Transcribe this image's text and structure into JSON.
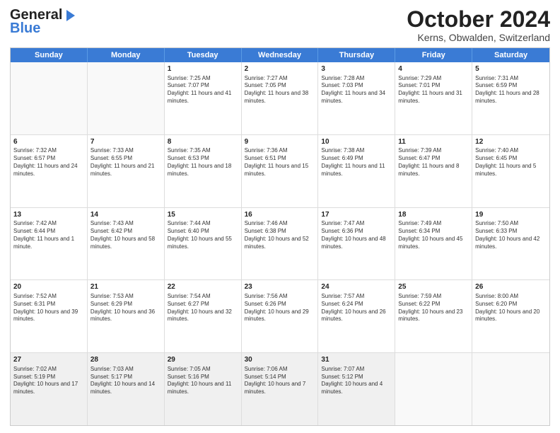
{
  "logo": {
    "line1": "General",
    "line2": "Blue"
  },
  "title": "October 2024",
  "subtitle": "Kerns, Obwalden, Switzerland",
  "days": [
    "Sunday",
    "Monday",
    "Tuesday",
    "Wednesday",
    "Thursday",
    "Friday",
    "Saturday"
  ],
  "weeks": [
    [
      {
        "day": "",
        "text": "",
        "empty": true
      },
      {
        "day": "",
        "text": "",
        "empty": true
      },
      {
        "day": "1",
        "text": "Sunrise: 7:25 AM\nSunset: 7:07 PM\nDaylight: 11 hours and 41 minutes."
      },
      {
        "day": "2",
        "text": "Sunrise: 7:27 AM\nSunset: 7:05 PM\nDaylight: 11 hours and 38 minutes."
      },
      {
        "day": "3",
        "text": "Sunrise: 7:28 AM\nSunset: 7:03 PM\nDaylight: 11 hours and 34 minutes."
      },
      {
        "day": "4",
        "text": "Sunrise: 7:29 AM\nSunset: 7:01 PM\nDaylight: 11 hours and 31 minutes."
      },
      {
        "day": "5",
        "text": "Sunrise: 7:31 AM\nSunset: 6:59 PM\nDaylight: 11 hours and 28 minutes."
      }
    ],
    [
      {
        "day": "6",
        "text": "Sunrise: 7:32 AM\nSunset: 6:57 PM\nDaylight: 11 hours and 24 minutes."
      },
      {
        "day": "7",
        "text": "Sunrise: 7:33 AM\nSunset: 6:55 PM\nDaylight: 11 hours and 21 minutes."
      },
      {
        "day": "8",
        "text": "Sunrise: 7:35 AM\nSunset: 6:53 PM\nDaylight: 11 hours and 18 minutes."
      },
      {
        "day": "9",
        "text": "Sunrise: 7:36 AM\nSunset: 6:51 PM\nDaylight: 11 hours and 15 minutes."
      },
      {
        "day": "10",
        "text": "Sunrise: 7:38 AM\nSunset: 6:49 PM\nDaylight: 11 hours and 11 minutes."
      },
      {
        "day": "11",
        "text": "Sunrise: 7:39 AM\nSunset: 6:47 PM\nDaylight: 11 hours and 8 minutes."
      },
      {
        "day": "12",
        "text": "Sunrise: 7:40 AM\nSunset: 6:45 PM\nDaylight: 11 hours and 5 minutes."
      }
    ],
    [
      {
        "day": "13",
        "text": "Sunrise: 7:42 AM\nSunset: 6:44 PM\nDaylight: 11 hours and 1 minute."
      },
      {
        "day": "14",
        "text": "Sunrise: 7:43 AM\nSunset: 6:42 PM\nDaylight: 10 hours and 58 minutes."
      },
      {
        "day": "15",
        "text": "Sunrise: 7:44 AM\nSunset: 6:40 PM\nDaylight: 10 hours and 55 minutes."
      },
      {
        "day": "16",
        "text": "Sunrise: 7:46 AM\nSunset: 6:38 PM\nDaylight: 10 hours and 52 minutes."
      },
      {
        "day": "17",
        "text": "Sunrise: 7:47 AM\nSunset: 6:36 PM\nDaylight: 10 hours and 48 minutes."
      },
      {
        "day": "18",
        "text": "Sunrise: 7:49 AM\nSunset: 6:34 PM\nDaylight: 10 hours and 45 minutes."
      },
      {
        "day": "19",
        "text": "Sunrise: 7:50 AM\nSunset: 6:33 PM\nDaylight: 10 hours and 42 minutes."
      }
    ],
    [
      {
        "day": "20",
        "text": "Sunrise: 7:52 AM\nSunset: 6:31 PM\nDaylight: 10 hours and 39 minutes."
      },
      {
        "day": "21",
        "text": "Sunrise: 7:53 AM\nSunset: 6:29 PM\nDaylight: 10 hours and 36 minutes."
      },
      {
        "day": "22",
        "text": "Sunrise: 7:54 AM\nSunset: 6:27 PM\nDaylight: 10 hours and 32 minutes."
      },
      {
        "day": "23",
        "text": "Sunrise: 7:56 AM\nSunset: 6:26 PM\nDaylight: 10 hours and 29 minutes."
      },
      {
        "day": "24",
        "text": "Sunrise: 7:57 AM\nSunset: 6:24 PM\nDaylight: 10 hours and 26 minutes."
      },
      {
        "day": "25",
        "text": "Sunrise: 7:59 AM\nSunset: 6:22 PM\nDaylight: 10 hours and 23 minutes."
      },
      {
        "day": "26",
        "text": "Sunrise: 8:00 AM\nSunset: 6:20 PM\nDaylight: 10 hours and 20 minutes."
      }
    ],
    [
      {
        "day": "27",
        "text": "Sunrise: 7:02 AM\nSunset: 5:19 PM\nDaylight: 10 hours and 17 minutes."
      },
      {
        "day": "28",
        "text": "Sunrise: 7:03 AM\nSunset: 5:17 PM\nDaylight: 10 hours and 14 minutes."
      },
      {
        "day": "29",
        "text": "Sunrise: 7:05 AM\nSunset: 5:16 PM\nDaylight: 10 hours and 11 minutes."
      },
      {
        "day": "30",
        "text": "Sunrise: 7:06 AM\nSunset: 5:14 PM\nDaylight: 10 hours and 7 minutes."
      },
      {
        "day": "31",
        "text": "Sunrise: 7:07 AM\nSunset: 5:12 PM\nDaylight: 10 hours and 4 minutes."
      },
      {
        "day": "",
        "text": "",
        "empty": true
      },
      {
        "day": "",
        "text": "",
        "empty": true
      }
    ]
  ]
}
